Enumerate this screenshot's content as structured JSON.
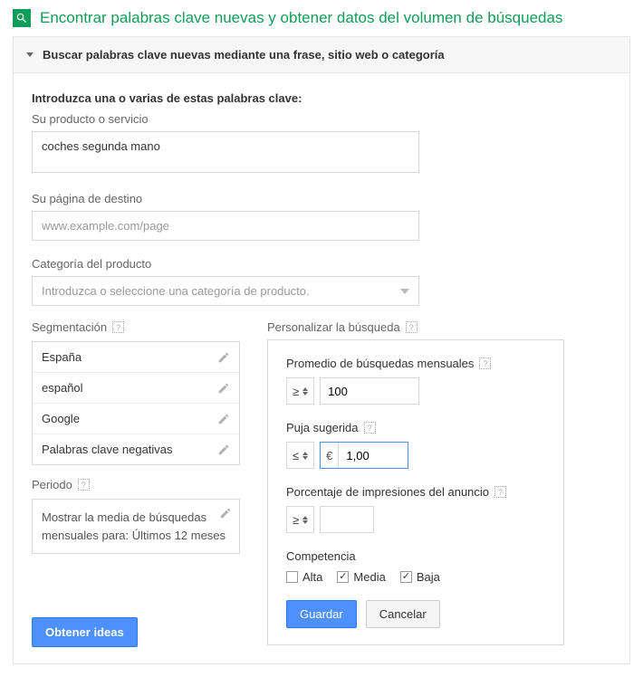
{
  "header": {
    "title": "Encontrar palabras clave nuevas y obtener datos del volumen de búsquedas"
  },
  "accordion": {
    "title": "Buscar palabras clave nuevas mediante una frase, sitio web o categoría"
  },
  "form": {
    "intro": "Introduzca una o varias de estas palabras clave:",
    "product_label": "Su producto o servicio",
    "product_value": "coches segunda mano",
    "landing_label": "Su página de destino",
    "landing_placeholder": "www.example.com/page",
    "category_label": "Categoría del producto",
    "category_placeholder": "Introduzca o seleccione una categoría de producto."
  },
  "segmentation": {
    "label": "Segmentación",
    "items": [
      "España",
      "español",
      "Google",
      "Palabras clave negativas"
    ]
  },
  "period": {
    "label": "Periodo",
    "text": "Mostrar la media de búsquedas mensuales para: Últimos 12 meses"
  },
  "customize": {
    "label": "Personalizar la búsqueda",
    "avg_label": "Promedio de búsquedas mensuales",
    "avg_op": "≥",
    "avg_value": "100",
    "bid_label": "Puja sugerida",
    "bid_op": "≤",
    "bid_currency": "€",
    "bid_value": "1,00",
    "imp_label": "Porcentaje de impresiones del anuncio",
    "imp_op": "≥",
    "imp_value": "",
    "comp_label": "Competencia",
    "comp_options": [
      {
        "label": "Alta",
        "checked": false
      },
      {
        "label": "Media",
        "checked": true
      },
      {
        "label": "Baja",
        "checked": true
      }
    ],
    "save": "Guardar",
    "cancel": "Cancelar"
  },
  "action": {
    "get_ideas": "Obtener ideas"
  }
}
